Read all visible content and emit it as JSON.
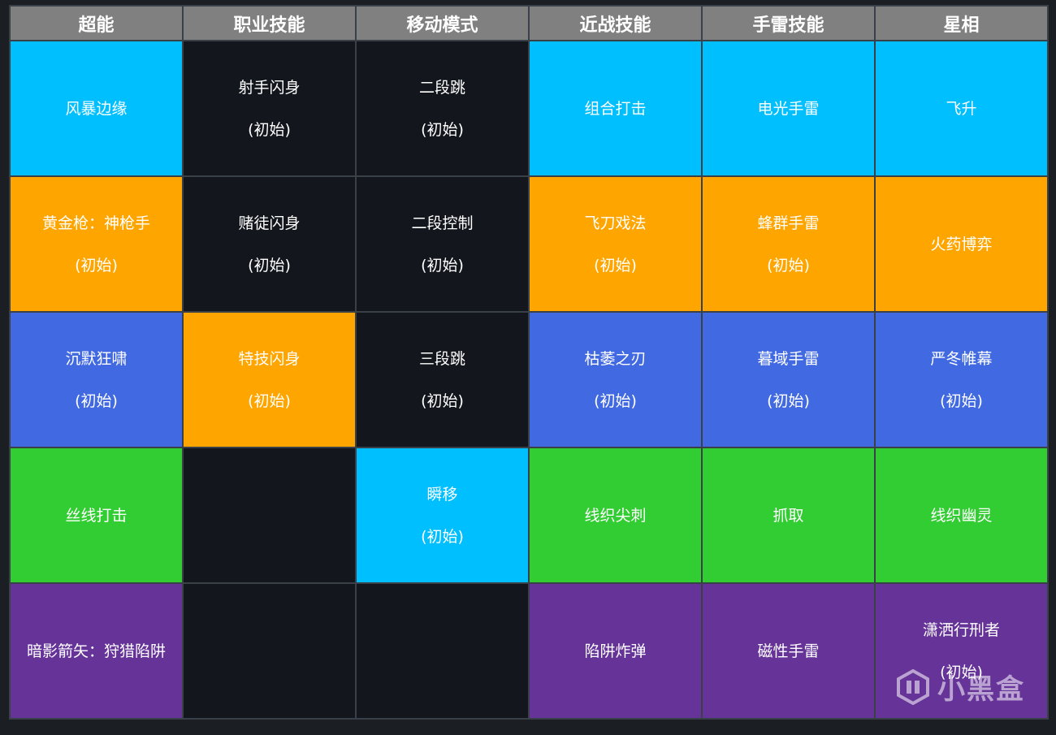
{
  "headers": [
    "超能",
    "职业技能",
    "移动模式",
    "近战技能",
    "手雷技能",
    "星相"
  ],
  "rows": [
    [
      {
        "lines": [
          "风暴边缘"
        ],
        "color": "cyan"
      },
      {
        "lines": [
          "射手闪身",
          "(初始)"
        ],
        "color": "dark"
      },
      {
        "lines": [
          "二段跳",
          "(初始)"
        ],
        "color": "dark"
      },
      {
        "lines": [
          "组合打击"
        ],
        "color": "cyan"
      },
      {
        "lines": [
          "电光手雷"
        ],
        "color": "cyan"
      },
      {
        "lines": [
          "飞升"
        ],
        "color": "cyan"
      }
    ],
    [
      {
        "lines": [
          "黄金枪：神枪手",
          "(初始)"
        ],
        "color": "orange"
      },
      {
        "lines": [
          "赌徒闪身",
          "(初始)"
        ],
        "color": "dark"
      },
      {
        "lines": [
          "二段控制",
          "(初始)"
        ],
        "color": "dark"
      },
      {
        "lines": [
          "飞刀戏法",
          "(初始)"
        ],
        "color": "orange"
      },
      {
        "lines": [
          "蜂群手雷",
          "(初始)"
        ],
        "color": "orange"
      },
      {
        "lines": [
          "火药博弈"
        ],
        "color": "orange"
      }
    ],
    [
      {
        "lines": [
          "沉默狂啸",
          "(初始)"
        ],
        "color": "blue"
      },
      {
        "lines": [
          "特技闪身",
          "(初始)"
        ],
        "color": "orange"
      },
      {
        "lines": [
          "三段跳",
          "(初始)"
        ],
        "color": "dark"
      },
      {
        "lines": [
          "枯萎之刃",
          "(初始)"
        ],
        "color": "blue"
      },
      {
        "lines": [
          "暮域手雷",
          "(初始)"
        ],
        "color": "blue"
      },
      {
        "lines": [
          "严冬帷幕",
          "(初始)"
        ],
        "color": "blue"
      }
    ],
    [
      {
        "lines": [
          "丝线打击"
        ],
        "color": "green"
      },
      {
        "lines": [],
        "color": "dark"
      },
      {
        "lines": [
          "瞬移",
          "(初始)"
        ],
        "color": "cyan"
      },
      {
        "lines": [
          "线织尖刺"
        ],
        "color": "green"
      },
      {
        "lines": [
          "抓取"
        ],
        "color": "green"
      },
      {
        "lines": [
          "线织幽灵"
        ],
        "color": "green"
      }
    ],
    [
      {
        "lines": [
          "暗影箭矢：狩猎陷阱"
        ],
        "color": "purple"
      },
      {
        "lines": [],
        "color": "dark"
      },
      {
        "lines": [],
        "color": "dark"
      },
      {
        "lines": [
          "陷阱炸弹"
        ],
        "color": "purple"
      },
      {
        "lines": [
          "磁性手雷"
        ],
        "color": "purple"
      },
      {
        "lines": [
          "潇洒行刑者",
          "(初始)"
        ],
        "color": "purple"
      }
    ]
  ],
  "colors": {
    "cyan": "#00bfff",
    "orange": "#ffa500",
    "blue": "#4169e1",
    "green": "#32cd32",
    "purple": "#663399",
    "dark": "#13171d",
    "header": "#808080"
  },
  "watermark": {
    "text": "小黑盒",
    "icon": "heybox-logo-icon"
  }
}
